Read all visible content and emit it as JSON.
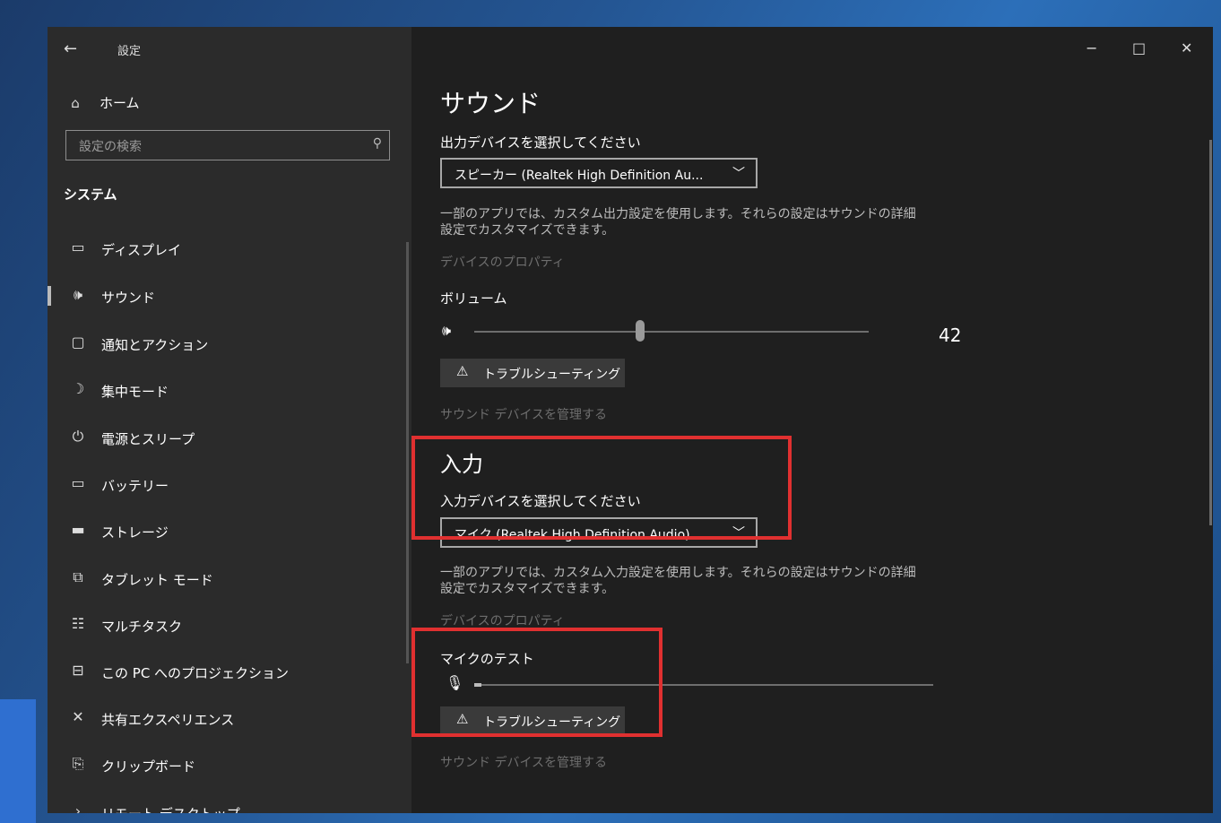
{
  "window": {
    "title": "設定",
    "controls": {
      "minimize": "−",
      "maximize": "□",
      "close": "✕"
    }
  },
  "sidebar": {
    "home_label": "ホーム",
    "search_placeholder": "設定の検索",
    "section_title": "システム",
    "items": [
      {
        "label": "ディスプレイ",
        "icon": "display-icon",
        "active": false
      },
      {
        "label": "サウンド",
        "icon": "speaker-icon",
        "active": true
      },
      {
        "label": "通知とアクション",
        "icon": "notification-icon",
        "active": false
      },
      {
        "label": "集中モード",
        "icon": "moon-icon",
        "active": false
      },
      {
        "label": "電源とスリープ",
        "icon": "power-icon",
        "active": false
      },
      {
        "label": "バッテリー",
        "icon": "battery-icon",
        "active": false
      },
      {
        "label": "ストレージ",
        "icon": "storage-icon",
        "active": false
      },
      {
        "label": "タブレット モード",
        "icon": "tablet-icon",
        "active": false
      },
      {
        "label": "マルチタスク",
        "icon": "multitask-icon",
        "active": false
      },
      {
        "label": "この PC へのプロジェクション",
        "icon": "projection-icon",
        "active": false
      },
      {
        "label": "共有エクスペリエンス",
        "icon": "shared-icon",
        "active": false
      },
      {
        "label": "クリップボード",
        "icon": "clipboard-icon",
        "active": false
      },
      {
        "label": "リモート デスクトップ",
        "icon": "remote-icon",
        "active": false
      }
    ]
  },
  "sound": {
    "title": "サウンド",
    "output": {
      "label": "出力デバイスを選択してください",
      "device": "スピーカー (Realtek High Definition Au...",
      "description_line1": "一部のアプリでは、カスタム出力設定を使用します。それらの設定はサウンドの詳細",
      "description_line2": "設定でカスタマイズできます。",
      "properties_link": "デバイスのプロパティ"
    },
    "volume": {
      "label": "ボリューム",
      "value": "42",
      "level": 0.42
    },
    "troubleshoot_label": "トラブルシューティング",
    "manage_devices_link": "サウンド デバイスを管理する"
  },
  "input": {
    "title": "入力",
    "label": "入力デバイスを選択してください",
    "device": "マイク (Realtek High Definition Audio)",
    "description_line1": "一部のアプリでは、カスタム入力設定を使用します。それらの設定はサウンドの詳細",
    "description_line2": "設定でカスタマイズできます。",
    "properties_link": "デバイスのプロパティ",
    "mic_test_label": "マイクのテスト",
    "mic_level": 0.0,
    "troubleshoot_label": "トラブルシューティング",
    "manage_devices_link": "サウンド デバイスを管理する"
  },
  "colors": {
    "highlight": "#e03030",
    "sidebar_bg": "#2b2b2b",
    "main_bg": "#1f1f1f"
  }
}
